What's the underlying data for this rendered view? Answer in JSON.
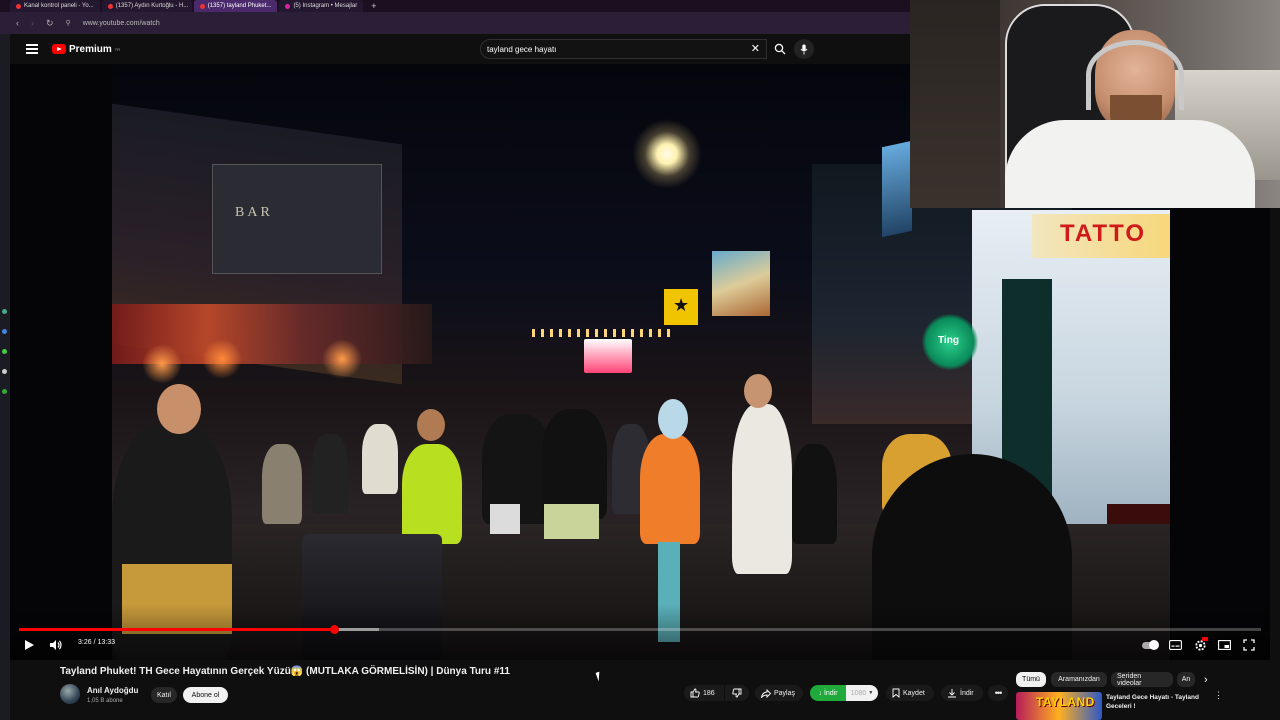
{
  "browser": {
    "tabs": [
      {
        "label": "Kanal kontrol paneli - Yo..."
      },
      {
        "label": "(1357) Aydın Kurtoğlu - H..."
      },
      {
        "label": "(1357) tayland Phuket..."
      },
      {
        "label": "(5) Instagram • Mesajlar"
      }
    ],
    "new_tab": "+",
    "url": "www.youtube.com/watch"
  },
  "youtube": {
    "logo_text": "Premium",
    "logo_sup": "TR",
    "search_value": "tayland gece hayatı"
  },
  "player": {
    "time_display": "3:26 / 13:33",
    "progress": 0.254,
    "buffered": 0.29,
    "toggle_on": true
  },
  "video_info": {
    "title": "Tayland Phuket! TH Gece Hayatının Gerçek Yüzü😱 (MUTLAKA GÖRMELİSİN) | Dünya Turu #11",
    "channel_name": "Anıl Aydoğdu",
    "subscribers": "1,05 B abone",
    "join_label": "Katıl",
    "subscribe_label": "Abone ol",
    "like_count": "186",
    "share_label": "Paylaş",
    "download_label": "İndir",
    "quality_label": "1080",
    "save_label": "Kaydet",
    "download2_label": "İndir"
  },
  "sidebar": {
    "chips": [
      "Tümü",
      "Aramanızdan",
      "Seriden videolar",
      "An"
    ],
    "rec_title": "Tayland Gece Hayatı - Tayland Geceleri !",
    "rec_thumb_text": "TAYLAND"
  },
  "scene_signs": {
    "tattoo": "TATTO",
    "bar": "BAR",
    "shop": "Ting"
  }
}
